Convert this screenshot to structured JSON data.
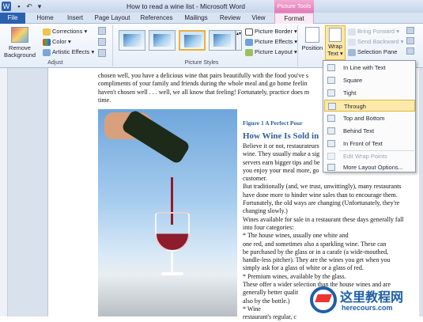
{
  "window": {
    "title": "How to read a wine list - Microsoft Word",
    "context_header": "Picture Tools"
  },
  "tabs": [
    "File",
    "Home",
    "Insert",
    "Page Layout",
    "References",
    "Mailings",
    "Review",
    "View",
    "Format"
  ],
  "ribbon": {
    "adjust": {
      "remove_bg": "Remove Background",
      "corrections": "Corrections",
      "color": "Color",
      "artistic": "Artistic Effects",
      "group": "Adjust"
    },
    "styles": {
      "group": "Picture Styles",
      "border": "Picture Border",
      "effects": "Picture Effects",
      "layout": "Picture Layout"
    },
    "arrange": {
      "position": "Position",
      "wrap": "Wrap Text",
      "bring_forward": "Bring Forward",
      "send_backward": "Send Backward",
      "selection_pane": "Selection Pane"
    }
  },
  "menu": {
    "items": [
      "In Line with Text",
      "Square",
      "Tight",
      "Through",
      "Top and Bottom",
      "Behind Text",
      "In Front of Text",
      "Edit Wrap Points",
      "More Layout Options..."
    ],
    "highlighted": "Through"
  },
  "doc": {
    "para1_l1": "chosen well,  you have a delicious wine that pairs beautifully  with the food you've s",
    "para1_l2": "compliments  of your family   and friends  during the whole meal  and go home feelin",
    "para1_l3": "haven't chosen well . . . well,  we all know that feeling!  Fortunately, practice does m",
    "para1_l4": "time.",
    "figure_caption": "Figure 1 A Perfect Pour",
    "heading": "How Wine Is Sold in",
    "lines": [
      "Believe it or not, restaurateurs",
      "wine. They usually make a sig",
      "servers earn bigger tips and be",
      "you enjoy your meal more, go",
      "customer.",
      "But traditionally (and, we trust, unwittingly), many restaurants",
      "have done more to hinder wine sales than to encourage them.",
      "Fortunately, the old ways are changing (Unfortunately, they're",
      "changing slowly.)",
      "Wines available for sale in a restaurant these days generally fall",
      "into four categories:",
      "* The house wines, usually one white and",
      "one red, and sometimes also a sparkling wine. These can",
      "be purchased by the glass or in a carafe (a wide-mouthed,",
      "handle-less pitcher). They are the wines you get when you",
      "simply ask for a glass of white or a glass of red.",
      "* Premium wines, available by the glass.",
      "These offer a wider selection than the house wines and are",
      "generally better qualit",
      "also by the bottle.)",
      "* Wine",
      "restaurant's regular, c"
    ]
  },
  "watermark": {
    "cn": "这里教程网",
    "url": "herecours.com"
  }
}
